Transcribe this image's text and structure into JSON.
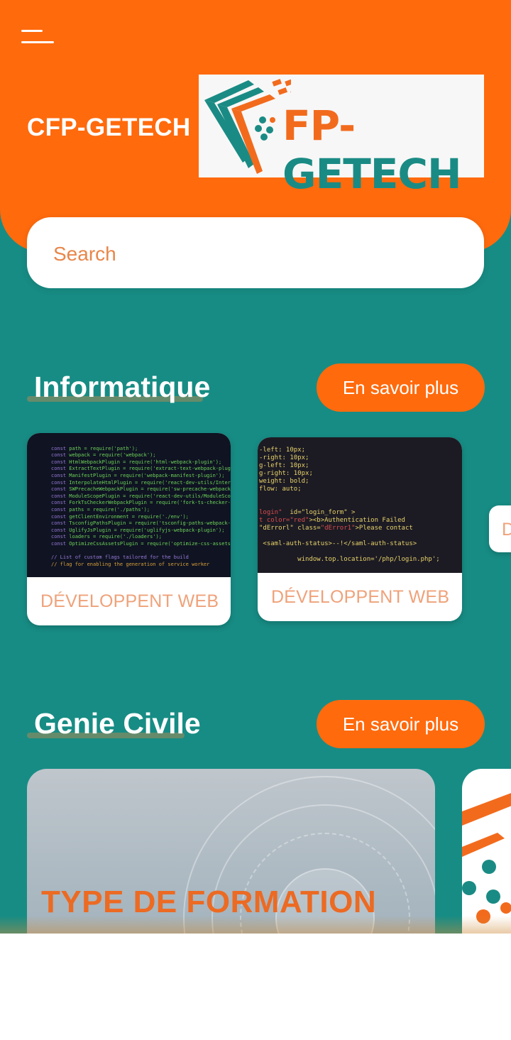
{
  "header": {
    "brand": "CFP-GETECH",
    "logo": {
      "text_prefix": "FP-",
      "text_suffix": "GETECH"
    }
  },
  "search": {
    "placeholder": "Search"
  },
  "sections": [
    {
      "title": "Informatique",
      "button_label": "En savoir plus",
      "cards": [
        {
          "label": "DÉVELOPPENT WEB"
        },
        {
          "label": "DÉVELOPPENT WEB"
        },
        {
          "label": "D"
        }
      ]
    },
    {
      "title": "Genie Civile",
      "button_label": "En savoir plus",
      "cards": [
        {
          "label": "TYPE DE FORMATION"
        }
      ]
    }
  ],
  "colors": {
    "accent_orange": "#ff6a0d",
    "teal_background": "#178c84",
    "card_label": "#efa27a"
  }
}
